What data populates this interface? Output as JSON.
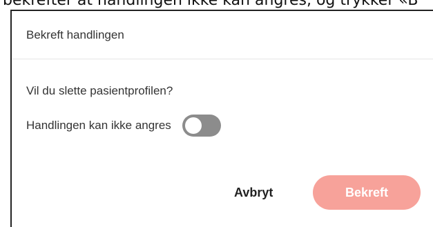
{
  "background": {
    "instruction_text": "bekrefter at handlingen ikke kan angres, og trykker «B"
  },
  "dialog": {
    "title": "Bekreft handlingen",
    "question": "Vil du slette pasientprofilen?",
    "toggle": {
      "label": "Handlingen kan ikke angres",
      "checked": false
    },
    "cancel_label": "Avbryt",
    "confirm_label": "Bekreft"
  },
  "colors": {
    "confirm_button_bg": "#f7a29a",
    "toggle_off_bg": "#8c8c8c"
  }
}
